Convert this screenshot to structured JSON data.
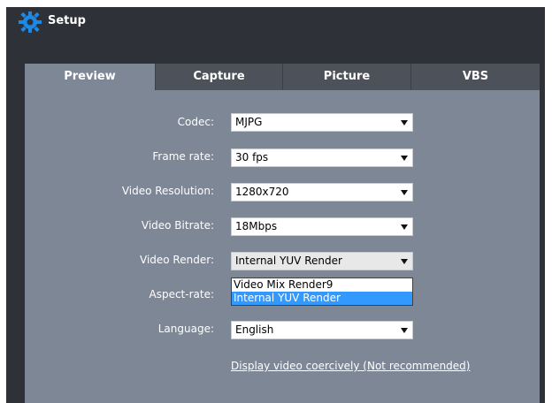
{
  "window": {
    "title": "Setup",
    "icon": "gear-icon"
  },
  "tabs": [
    {
      "label": "Preview",
      "active": true
    },
    {
      "label": "Capture",
      "active": false
    },
    {
      "label": "Picture",
      "active": false
    },
    {
      "label": "VBS",
      "active": false
    }
  ],
  "settings": {
    "codec": {
      "label": "Codec:",
      "value": "MJPG"
    },
    "frame_rate": {
      "label": "Frame rate:",
      "value": "30 fps"
    },
    "video_resolution": {
      "label": "Video Resolution:",
      "value": "1280x720"
    },
    "video_bitrate": {
      "label": "Video Bitrate:",
      "value": "18Mbps"
    },
    "video_render": {
      "label": "Video Render:",
      "value": "Internal YUV Render",
      "options": [
        "Video Mix Render9",
        "Internal YUV Render"
      ],
      "selected_option": "Internal YUV Render"
    },
    "aspect_rate": {
      "label": "Aspect-rate:"
    },
    "language": {
      "label": "Language:",
      "value": "English"
    }
  },
  "link": {
    "text": "Display video coercively (Not recommended)"
  },
  "colors": {
    "window_bg": "#2e3138",
    "panel_bg": "#7e8796",
    "tab_inactive": "#4d5159",
    "highlight": "#3399ff",
    "icon_blue": "#1e88e5"
  }
}
